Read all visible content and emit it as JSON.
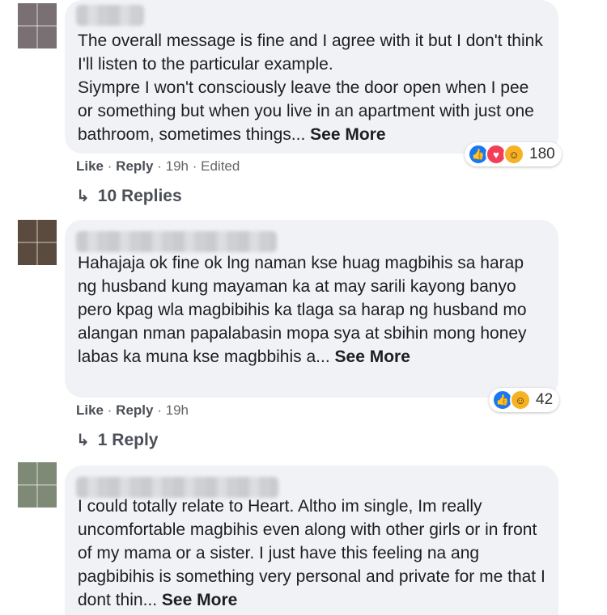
{
  "comments": [
    {
      "paragraphs": [
        "The overall message is fine and I agree with it but I don't think I'll listen to the particular example.",
        "Siympre I won't consciously leave the door open when I pee or something but when you live in an apartment with just one bathroom, sometimes things..."
      ],
      "see_more": "See More",
      "reactions": {
        "icons": [
          "like-icon",
          "love-icon",
          "haha-icon"
        ],
        "count": "180"
      },
      "actions": {
        "like": "Like",
        "reply": "Reply",
        "time": "19h",
        "edited": "Edited"
      },
      "replies_label": "10 Replies"
    },
    {
      "paragraphs": [
        "Hahajaja ok fine ok lng naman kse huag magbihis sa harap ng husband kung mayaman ka at may sarili kayong banyo pero kpag wla magbibihis ka tlaga sa harap ng husband mo alangan nman papalabasin mopa sya at sbihin mong honey labas ka muna kse magbbihis a..."
      ],
      "see_more": "See More",
      "reactions": {
        "icons": [
          "like-icon",
          "haha-icon"
        ],
        "count": "42"
      },
      "actions": {
        "like": "Like",
        "reply": "Reply",
        "time": "19h"
      },
      "replies_label": "1 Reply"
    },
    {
      "paragraphs": [
        "I could totally relate to Heart. Altho im single, Im really uncomfortable magbihis even along with other girls or in front of my mama or a sister. I just have this feeling na ang pagbibihis is something very personal and private for me that I dont thin..."
      ],
      "see_more": "See More"
    }
  ],
  "separator": "·",
  "colors": {
    "bubble": "#f0f2f5",
    "text": "#1c1e21",
    "meta": "#65676b",
    "like": "#1877f2",
    "love": "#f33e58",
    "haha": "#f7b125"
  }
}
